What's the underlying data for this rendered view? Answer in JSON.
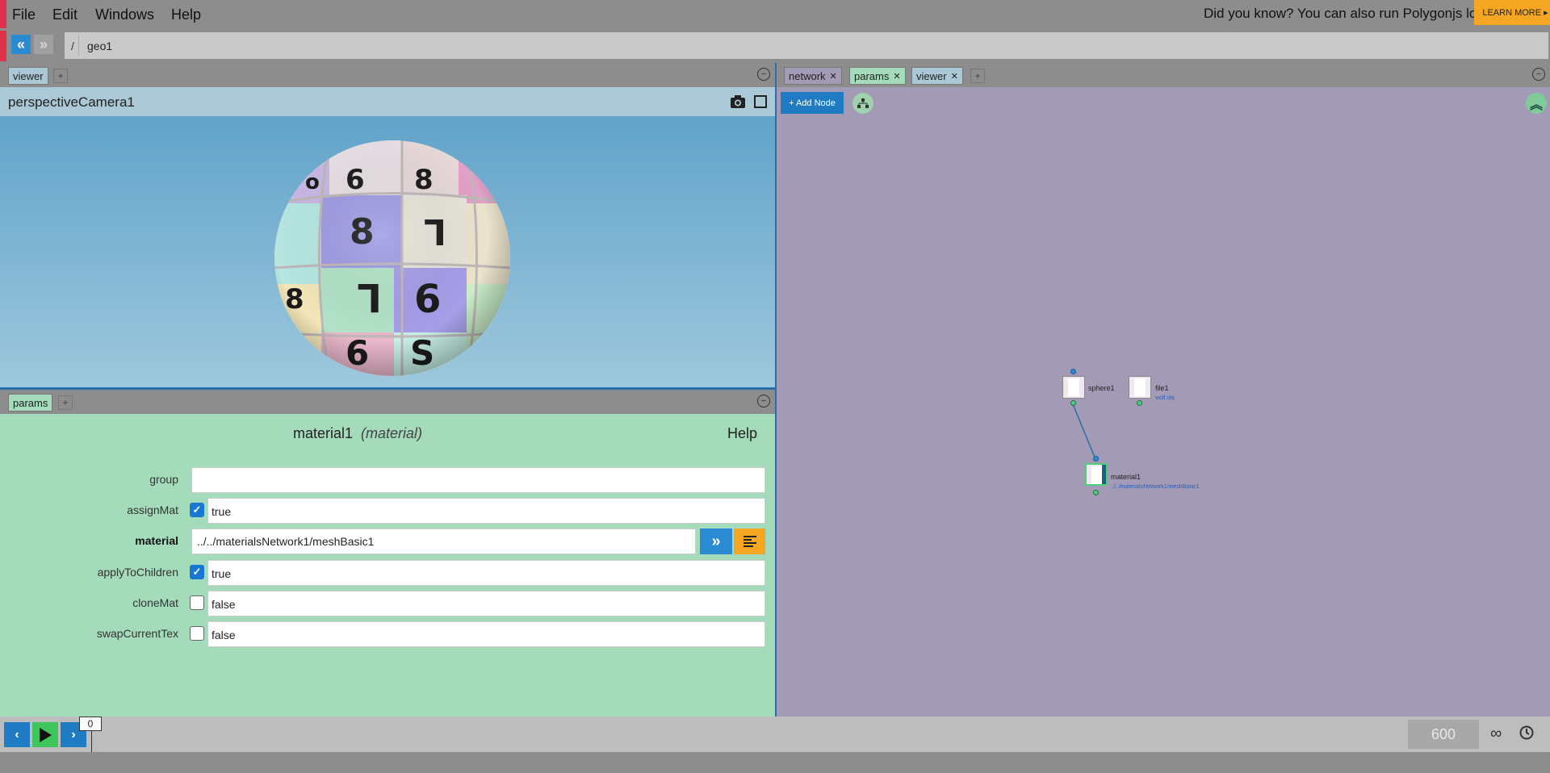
{
  "menu": {
    "file": "File",
    "edit": "Edit",
    "windows": "Windows",
    "help": "Help"
  },
  "banner": {
    "text": "Did you know? You can also run Polygonjs locally",
    "button": "LEARN MORE ▸"
  },
  "pathbar": {
    "root": "/",
    "node": "geo1"
  },
  "left_pane": {
    "viewer_tab": "viewer",
    "params_tab": "params",
    "add_tab": "+",
    "collapse": "−",
    "camera_title": "perspectiveCamera1"
  },
  "params": {
    "node_name": "material1",
    "node_type": "(material)",
    "help": "Help",
    "rows": [
      {
        "label": "group",
        "value": ""
      },
      {
        "label": "assignMat",
        "value": "true",
        "checked": true
      },
      {
        "label": "material",
        "value": "../../materialsNetwork1/meshBasic1"
      },
      {
        "label": "applyToChildren",
        "value": "true",
        "checked": true
      },
      {
        "label": "cloneMat",
        "value": "false",
        "checked": false
      },
      {
        "label": "swapCurrentTex",
        "value": "false",
        "checked": false
      }
    ]
  },
  "right_pane": {
    "tabs": [
      {
        "label": "network",
        "close": "✕"
      },
      {
        "label": "params",
        "close": "✕"
      },
      {
        "label": "viewer",
        "close": "✕"
      }
    ],
    "add_tab": "+",
    "collapse": "−",
    "add_node": "+ Add Node"
  },
  "network": {
    "nodes": [
      {
        "name": "sphere1",
        "sub": ""
      },
      {
        "name": "file1",
        "sub": "wolf.obj"
      },
      {
        "name": "material1",
        "sub": "../../materialsNetwork1/meshBasic1"
      }
    ]
  },
  "timeline": {
    "current_frame": "0",
    "end_frame": "600",
    "loop": "∞"
  },
  "colors": {
    "accent_blue": "#1f7cc2",
    "accent_orange": "#f5a623",
    "play_green": "#3ec55b",
    "params_bg": "#a3dbbb",
    "network_bg": "#a39bb5"
  }
}
